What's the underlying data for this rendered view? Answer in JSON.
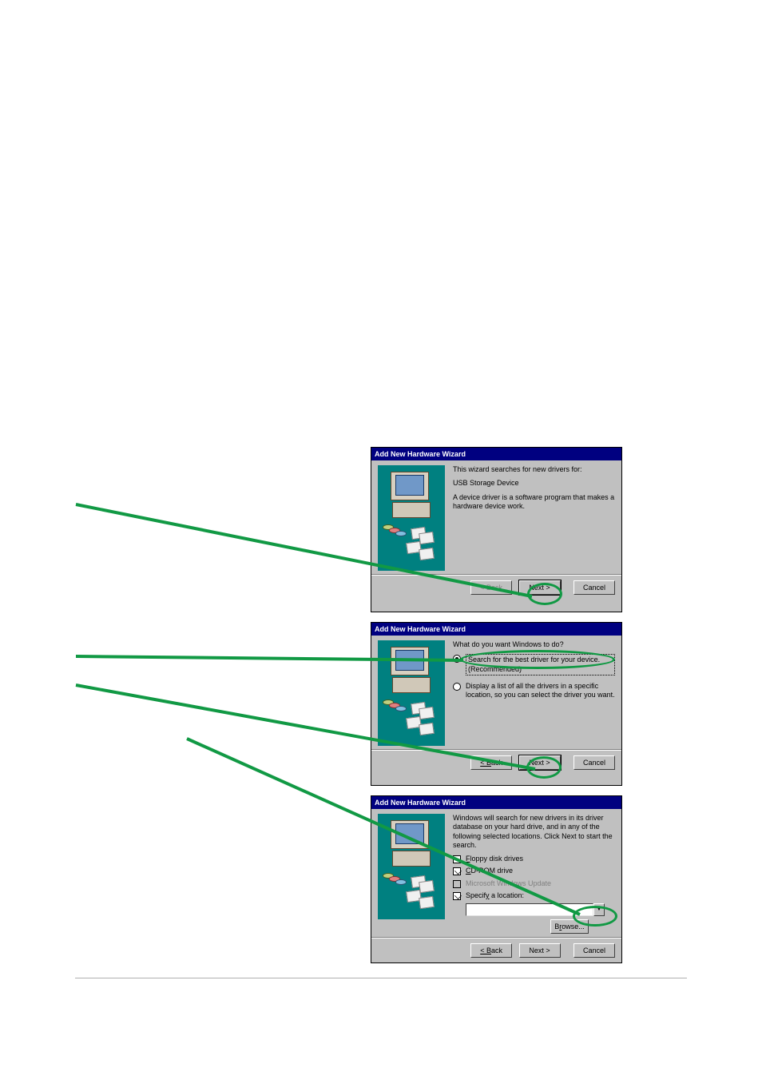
{
  "dialog_title": "Add New Hardware Wizard",
  "wizard1": {
    "line1": "This wizard searches for new drivers for:",
    "device": "USB Storage Device",
    "line2": "A device driver is a software program that makes a hardware device work.",
    "back": "< Back",
    "next": "Next >",
    "cancel": "Cancel"
  },
  "wizard2": {
    "prompt": "What do you want Windows to do?",
    "option1": "Search for the best driver for your device. (Recommended)",
    "option2": "Display a list of all the drivers in a specific location, so you can select the driver you want.",
    "back": "< Back",
    "next": "Next >",
    "cancel": "Cancel"
  },
  "wizard3": {
    "intro": "Windows will search for new drivers in its driver database on your hard drive, and in any of the following selected locations. Click Next to start the search.",
    "chk_floppy": "Floppy disk drives",
    "chk_cdrom": "CD-ROM drive",
    "chk_winupdate": "Microsoft Windows Update",
    "chk_location": "Specify a location:",
    "browse": "Browse...",
    "back": "< Back",
    "next": "Next >",
    "cancel": "Cancel"
  }
}
